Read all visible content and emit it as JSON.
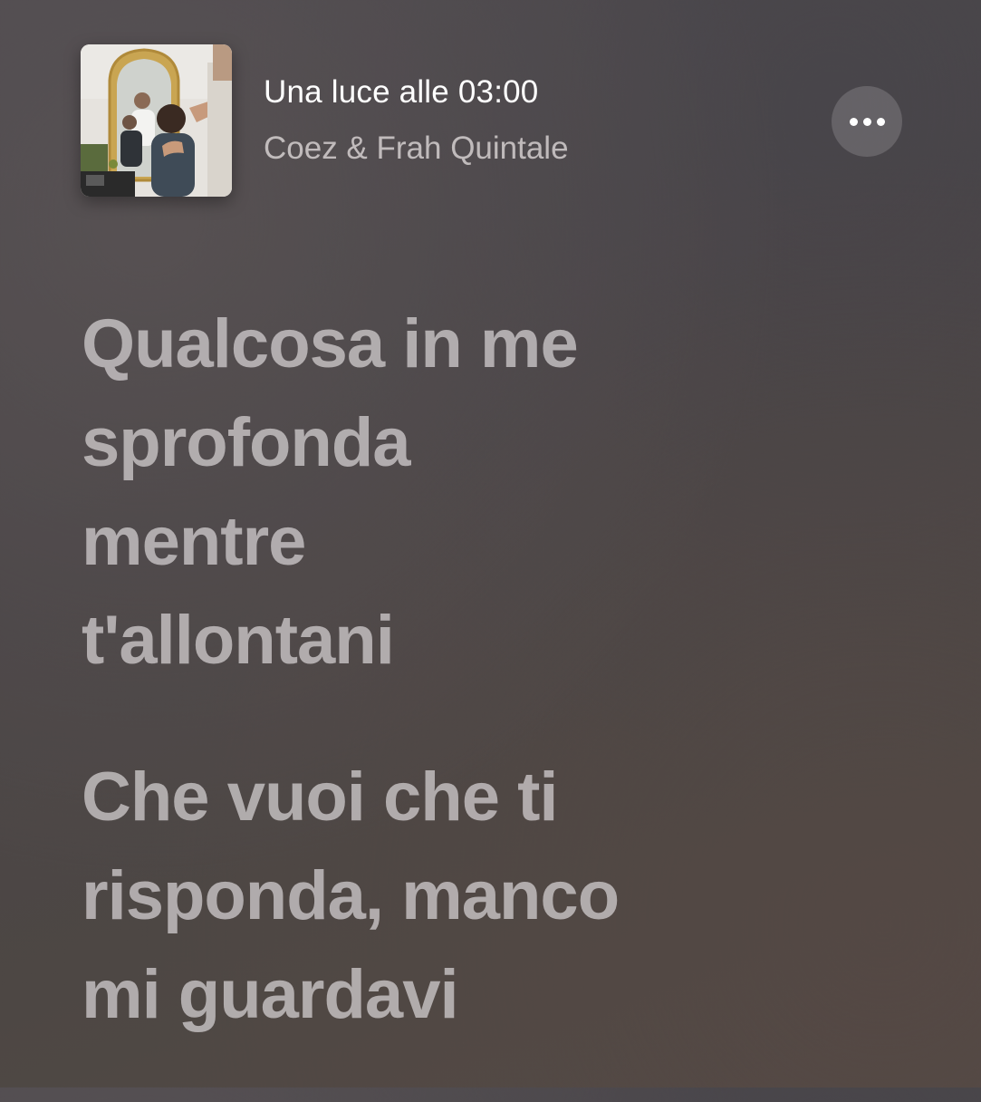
{
  "now_playing": {
    "title": "Una luce alle 03:00",
    "artist": "Coez & Frah Quintale",
    "more_icon": "ellipsis-icon"
  },
  "lyrics": [
    {
      "lines": [
        "Qualcosa in me",
        "sprofonda",
        "mentre",
        "t'allontani"
      ]
    },
    {
      "lines": [
        "Che vuoi che ti",
        "risponda, manco",
        "mi guardavi"
      ]
    }
  ]
}
